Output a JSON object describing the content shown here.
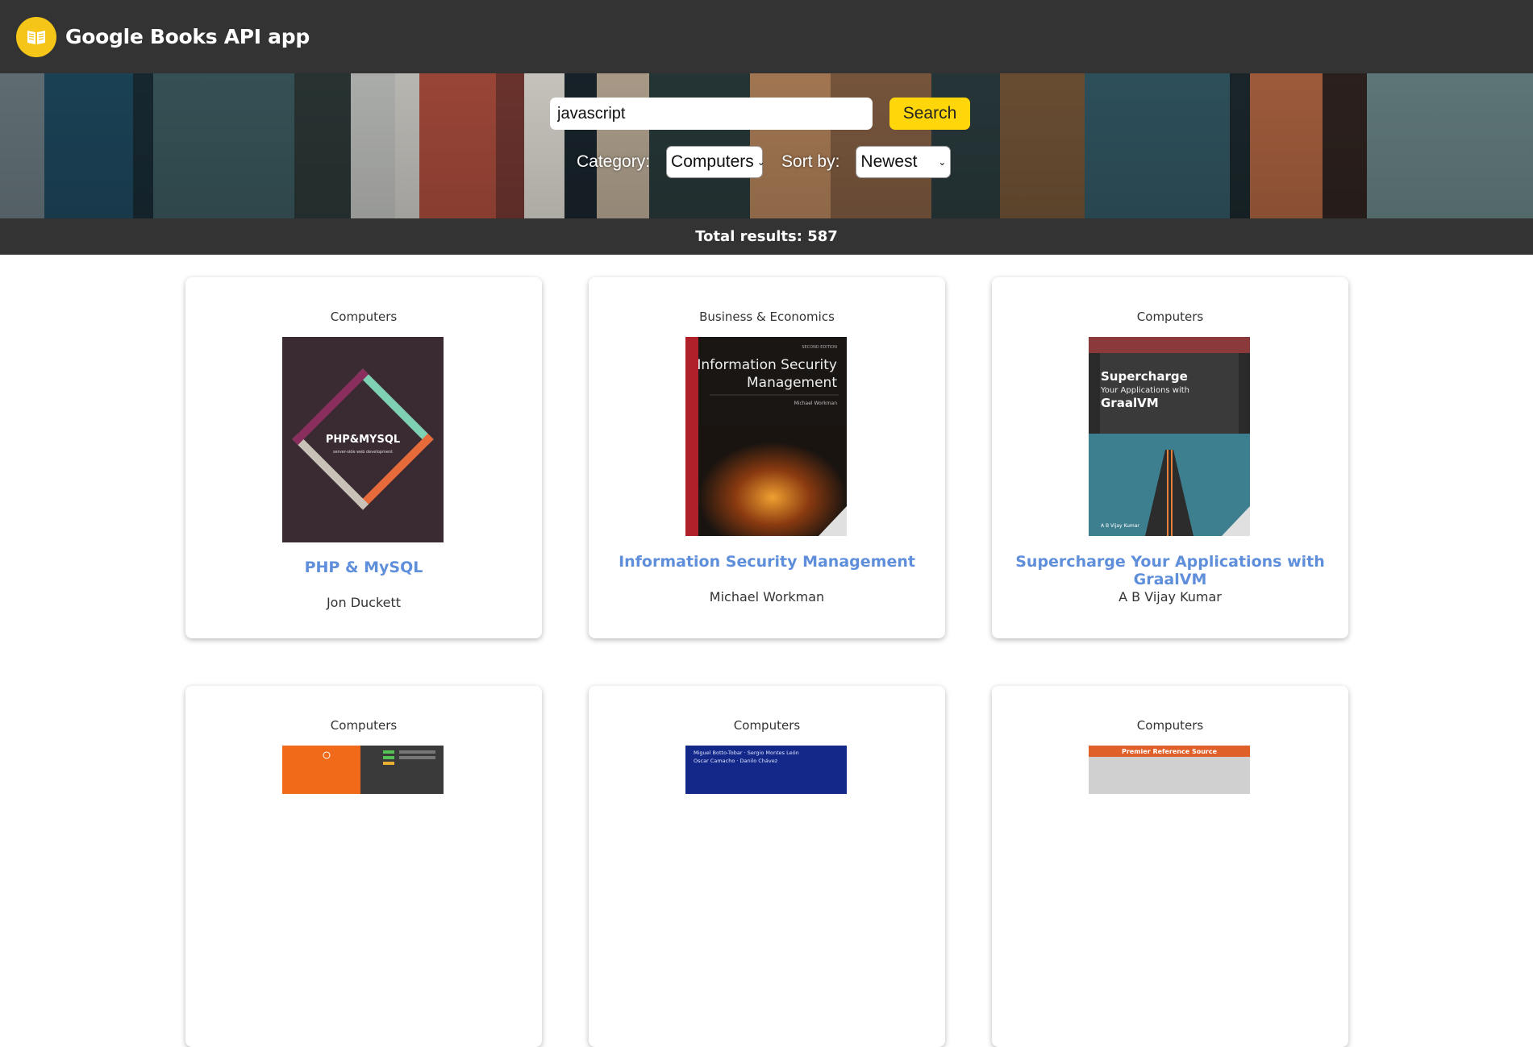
{
  "header": {
    "title": "Google Books API app",
    "logo_icon": "open-book-icon",
    "accent": "#f5c518"
  },
  "search": {
    "query": "javascript",
    "button_label": "Search"
  },
  "filters": {
    "category_label": "Category:",
    "category_value": "Computers",
    "sort_label": "Sort by:",
    "sort_value": "Newest"
  },
  "results": {
    "total_text": "Total results: 587"
  },
  "books": [
    {
      "category": "Computers",
      "title": "PHP & MySQL",
      "author": "Jon Duckett",
      "cover": {
        "title_text": "PHP&MYSQL",
        "sub_text": "server-side web development"
      }
    },
    {
      "category": "Business & Economics",
      "title": "Information Security Management",
      "author": "Michael Workman",
      "cover": {
        "edition": "SECOND EDITION",
        "title_line1": "Information Security",
        "title_line2": "Management",
        "author": "Michael Workman"
      }
    },
    {
      "category": "Computers",
      "title": "Supercharge Your Applications with GraalVM",
      "author": "A B Vijay Kumar",
      "cover": {
        "line1": "Supercharge",
        "line2": "Your Applications with",
        "line3": "GraalVM",
        "author": "A B Vijay Kumar"
      }
    },
    {
      "category": "Computers"
    },
    {
      "category": "Computers",
      "cover": {
        "authors_line1": "Miguel Botto-Tobar · Sergio Montes León",
        "authors_line2": "Oscar Camacho · Danilo Chávez"
      }
    },
    {
      "category": "Computers",
      "cover": {
        "banner": "Premier Reference Source"
      }
    }
  ]
}
